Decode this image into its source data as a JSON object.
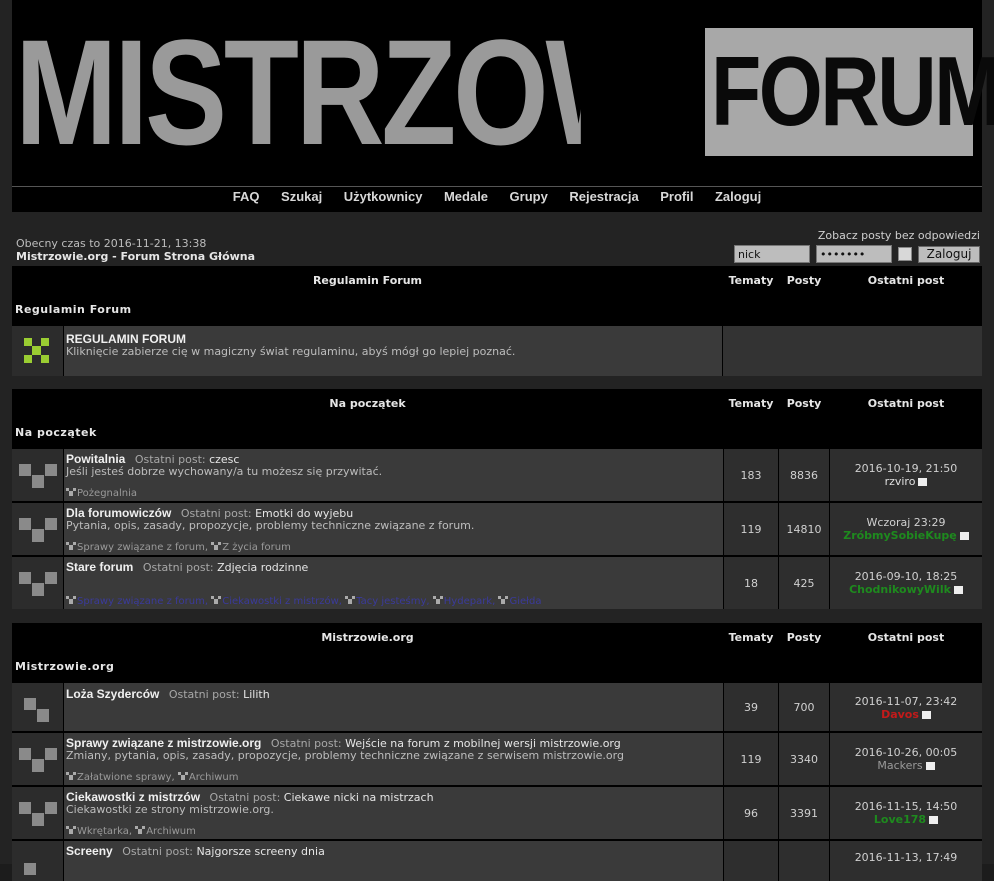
{
  "header": {
    "logo_main": "MISTRZOWIE",
    "logo_box": "FORUM",
    "nav": [
      "FAQ",
      "Szukaj",
      "Użytkownicy",
      "Medale",
      "Grupy",
      "Rejestracja",
      "Profil",
      "Zaloguj"
    ]
  },
  "info": {
    "time": "Obecny czas to 2016-11-21, 13:38",
    "breadcrumb": "Mistrzowie.org - Forum Strona Główna",
    "unanswered": "Zobacz posty bez odpowiedzi",
    "login_value": "nick",
    "password_value": "•••••••",
    "login_button": "Zaloguj"
  },
  "columns": {
    "topics": "Tematy",
    "posts": "Posty",
    "last": "Ostatni post"
  },
  "sections": [
    {
      "header": "Regulamin Forum",
      "category": "Regulamin Forum",
      "forums": [
        {
          "name": "REGULAMIN FORUM",
          "desc": "Kliknięcie zabierze cię w magiczny świat regulaminu, abyś mógł go lepiej poznać."
        }
      ]
    },
    {
      "header": "Na początek",
      "category": "Na początek",
      "forums": [
        {
          "name": "Powitalnia",
          "lastpost_label": "Ostatni post:",
          "lastpost": "czesc",
          "desc": "Jeśli jesteś dobrze wychowany/a tu możesz się przywitać.",
          "subs": [
            "Pożegnalnia"
          ],
          "topics": "183",
          "posts": "8836",
          "last_date": "2016-10-19, 21:50",
          "last_user": "rzviro",
          "user_color": "#e0e0e0"
        },
        {
          "name": "Dla forumowiczów",
          "lastpost_label": "Ostatni post:",
          "lastpost": "Emotki do wyjebu",
          "desc": "Pytania, opis, zasady, propozycje, problemy techniczne związane z forum.",
          "subs": [
            "Sprawy związane z forum",
            "Z życia forum"
          ],
          "topics": "119",
          "posts": "14810",
          "last_date": "Wczoraj 23:29",
          "last_user": "ZróbmySobieKupę",
          "user_color": "#1e8a1e"
        },
        {
          "name": "Stare forum",
          "lastpost_label": "Ostatni post:",
          "lastpost": "Zdjęcia rodzinne",
          "desc": "",
          "subs": [
            "Sprawy związane z forum",
            "Ciekawostki z mistrzów",
            "Tacy jesteśmy",
            "Hydepark",
            "Giełda"
          ],
          "topics": "18",
          "posts": "425",
          "last_date": "2016-09-10, 18:25",
          "last_user": "ChodnikowyWilk",
          "user_color": "#1e8a1e"
        }
      ]
    },
    {
      "header": "Mistrzowie.org",
      "category": "Mistrzowie.org",
      "forums": [
        {
          "name": "Loża Szyderców",
          "lastpost_label": "Ostatni post:",
          "lastpost": "Lilith",
          "desc": "",
          "subs": [],
          "topics": "39",
          "posts": "700",
          "last_date": "2016-11-07, 23:42",
          "last_user": "Davos",
          "user_color": "#c41a1a"
        },
        {
          "name": "Sprawy związane z mistrzowie.org",
          "lastpost_label": "Ostatni post:",
          "lastpost": "Wejście na forum z mobilnej wersji mistrzowie.org",
          "desc": "Zmiany, pytania, opis, zasady, propozycje, problemy techniczne związane z serwisem mistrzowie.org",
          "subs": [
            "Załatwione sprawy",
            "Archiwum"
          ],
          "topics": "119",
          "posts": "3340",
          "last_date": "2016-10-26, 00:05",
          "last_user": "Mackers",
          "user_color": "#9a9a9a"
        },
        {
          "name": "Ciekawostki z mistrzów",
          "lastpost_label": "Ostatni post:",
          "lastpost": "Ciekawe nicki na mistrzach",
          "desc": "Ciekawostki ze strony mistrzowie.org.",
          "subs": [
            "Wkrętarka",
            "Archiwum"
          ],
          "topics": "96",
          "posts": "3391",
          "last_date": "2016-11-15, 14:50",
          "last_user": "Love178",
          "user_color": "#1e8a1e"
        },
        {
          "name": "Screeny",
          "lastpost_label": "Ostatni post:",
          "lastpost": "Najgorsze screeny dnia",
          "desc": "",
          "subs": [],
          "topics": "",
          "posts": "",
          "last_date": "2016-11-13, 17:49",
          "last_user": "",
          "user_color": "#e0e0e0"
        }
      ]
    }
  ]
}
